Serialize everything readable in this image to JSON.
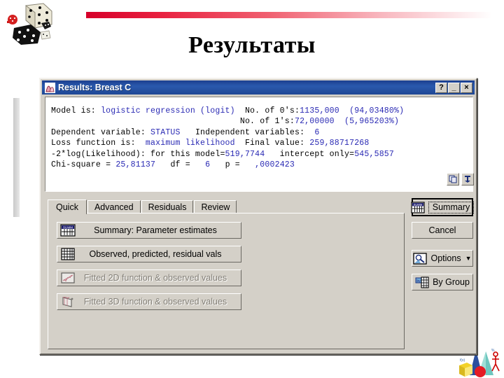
{
  "slide": {
    "title": "Результаты",
    "decor": {
      "dice_clipart": "dice-clipart",
      "shapes_clipart": "3d-shapes-clipart",
      "rule_color": "#d6002a",
      "left_bar_color": "#c9c9c9"
    }
  },
  "dialog": {
    "title": "Results: Breast C",
    "title_icon": "statistica-window-icon",
    "titlebar_buttons": [
      {
        "name": "help-button",
        "label": "?"
      },
      {
        "name": "minimize-button",
        "label": "_"
      },
      {
        "name": "close-button",
        "label": "×"
      }
    ],
    "output": {
      "lines": [
        [
          {
            "t": "Model is: ",
            "c": "k"
          },
          {
            "t": "logistic regression (logit)",
            "c": "b"
          },
          {
            "t": "  No. of 0's:",
            "c": "k"
          },
          {
            "t": "1135,000  (94,03480%)",
            "c": "b"
          }
        ],
        [
          {
            "t": "                                      No. of 1's:",
            "c": "k"
          },
          {
            "t": "72,00000  (5,965203%)",
            "c": "b"
          }
        ],
        [
          {
            "t": "Dependent variable: ",
            "c": "k"
          },
          {
            "t": "STATUS",
            "c": "b"
          },
          {
            "t": "   Independent variables:  ",
            "c": "k"
          },
          {
            "t": "6",
            "c": "b"
          }
        ],
        [
          {
            "t": "Loss function is:  ",
            "c": "k"
          },
          {
            "t": "maximum likelihood",
            "c": "b"
          },
          {
            "t": "  Final value: ",
            "c": "k"
          },
          {
            "t": "259,88717268",
            "c": "b"
          }
        ],
        [
          {
            "t": "-2*log(Likelihood): for this model=",
            "c": "k"
          },
          {
            "t": "519,7744",
            "c": "b"
          },
          {
            "t": "   intercept only=",
            "c": "k"
          },
          {
            "t": "545,5857",
            "c": "b"
          }
        ],
        [
          {
            "t": "Chi-square = ",
            "c": "k"
          },
          {
            "t": "25,81137",
            "c": "b"
          },
          {
            "t": "   df = ",
            "c": "k"
          },
          {
            "t": "  6",
            "c": "b"
          },
          {
            "t": "   p = ",
            "c": "k"
          },
          {
            "t": "  ,0002423",
            "c": "b"
          }
        ]
      ],
      "value_color": "#2a2ab4",
      "label_color": "#000000",
      "tools": [
        {
          "name": "copy-to-clipboard-button",
          "icon": "copy-icon"
        },
        {
          "name": "pin-button",
          "icon": "pin-icon"
        }
      ]
    },
    "tabs": [
      {
        "label": "Quick",
        "active": true
      },
      {
        "label": "Advanced",
        "active": false
      },
      {
        "label": "Residuals",
        "active": false
      },
      {
        "label": "Review",
        "active": false
      }
    ],
    "quick_tab_buttons": [
      {
        "label": "Summary: Parameter estimates",
        "icon": "summary-spreadsheet-icon",
        "enabled": true
      },
      {
        "label": "Observed, predicted, residual vals",
        "icon": "table-grid-icon",
        "enabled": true
      },
      {
        "label": "Fitted 2D function & observed values",
        "icon": "scatter-2d-icon",
        "enabled": false
      },
      {
        "label": "Fitted 3D function & observed values",
        "icon": "surface-3d-icon",
        "enabled": false
      }
    ],
    "side_buttons": [
      {
        "label": "Summary",
        "icon": "summary-spreadsheet-icon",
        "name": "summary-button",
        "default": true
      },
      {
        "label": "Cancel",
        "icon": null,
        "name": "cancel-button",
        "default": false
      },
      {
        "label": "Options",
        "icon": "options-icon",
        "name": "options-button",
        "default": false,
        "caret": "▼"
      },
      {
        "label": "By Group",
        "icon": "by-group-icon",
        "name": "by-group-button",
        "default": false
      }
    ]
  }
}
